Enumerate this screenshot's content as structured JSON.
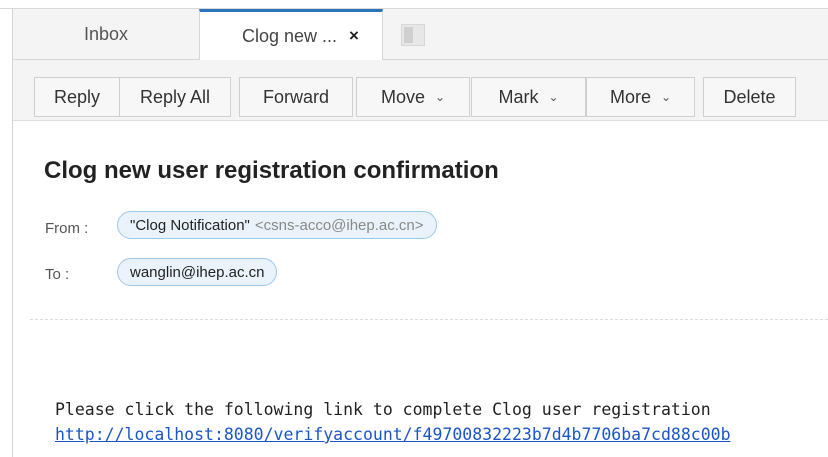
{
  "tabs": [
    {
      "label": "Inbox"
    },
    {
      "label": "Clog new ...",
      "close": "×"
    }
  ],
  "toolbar": {
    "reply": "Reply",
    "reply_all": "Reply All",
    "forward": "Forward",
    "move": "Move",
    "mark": "Mark",
    "more": "More",
    "delete": "Delete",
    "caret": "⌄"
  },
  "message": {
    "subject": "Clog new user registration confirmation",
    "from_label": "From :",
    "from_name": "\"Clog Notification\"",
    "from_address": "<csns-acco@ihep.ac.cn>",
    "to_label": "To :",
    "to_address": "wanglin@ihep.ac.cn",
    "body_line": "Please click the following link to complete Clog user registration",
    "body_link": "http://localhost:8080/verifyaccount/f49700832223b7d4b7706ba7cd88c00b"
  }
}
